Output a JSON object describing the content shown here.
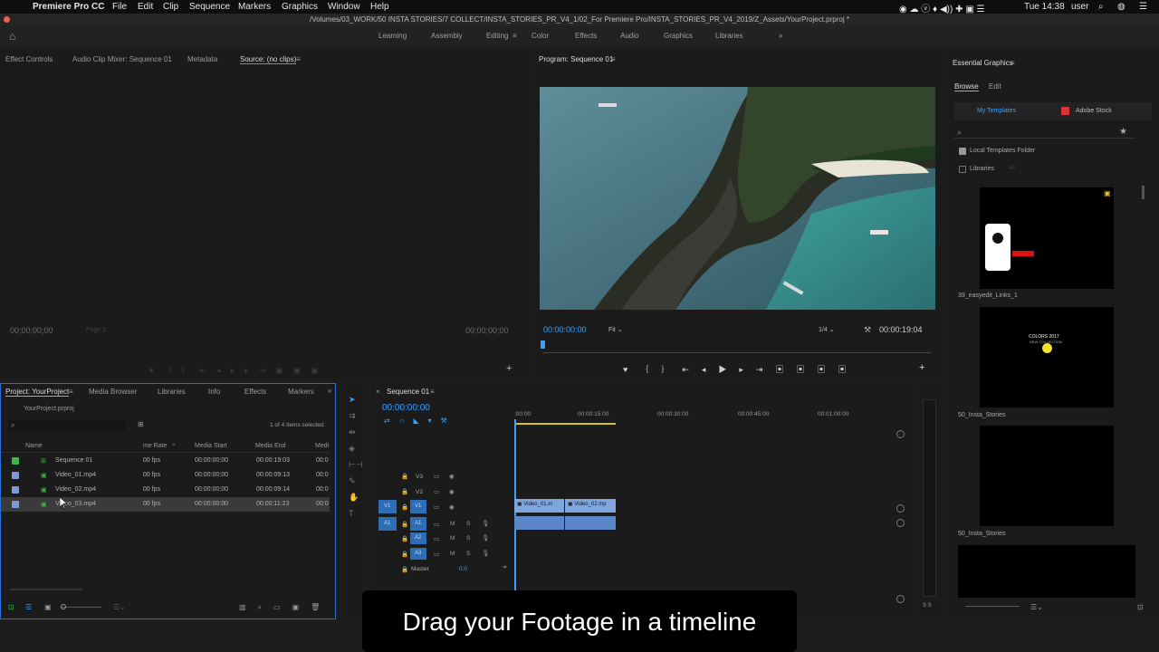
{
  "menubar": {
    "apple": "",
    "app": "Premiere Pro CC",
    "items": [
      "File",
      "Edit",
      "Clip",
      "Sequence",
      "Markers",
      "Graphics",
      "Window",
      "Help"
    ],
    "clock": "Tue 14:38",
    "user": "user"
  },
  "titlebar": {
    "path": "/Volumes/03_WORK/50 INSTA STORIES/7 COLLECT/INSTA_STORIES_PR_V4_1/02_For Premiere Pro/INSTA_STORIES_PR_V4_2019/Z_Assets/YourProject.prproj *"
  },
  "workspaces": {
    "items": [
      "Learning",
      "Assembly",
      "Editing",
      "Color",
      "Effects",
      "Audio",
      "Graphics",
      "Libraries"
    ],
    "active": "Editing",
    "more": "»"
  },
  "source": {
    "tabs": [
      "Effect Controls",
      "Audio Clip Mixer: Sequence 01",
      "Metadata",
      "Source: (no clips)"
    ],
    "tc_left": "00;00;00;00",
    "tc_right": "00;00;00;00",
    "page": "Page 1"
  },
  "program": {
    "title": "Program: Sequence 01",
    "tc": "00:00:00:00",
    "fit": "Fit",
    "ratio": "1/4",
    "duration": "00:00:19:04"
  },
  "essential": {
    "title": "Essential Graphics",
    "tabs": [
      "Browse",
      "Edit"
    ],
    "my_templates": "My Templates",
    "adobe_stock": "Adobe Stock",
    "local_folder": "Local Templates Folder",
    "libraries": "Libraries",
    "libraries_filter": "All",
    "items": [
      "39_easyedit_Links_1",
      "50_Insta_Stories",
      "50_Insta_Stories"
    ],
    "colors_title": "COLORS 2017",
    "colors_sub": "NEW COLLECTION"
  },
  "project": {
    "tabs": [
      "Project: YourProject",
      "Media Browser",
      "Libraries",
      "Info",
      "Effects",
      "Markers"
    ],
    "file": "YourProject.prproj",
    "selected": "1 of 4 items selected",
    "columns": [
      "Name",
      "me Rate",
      "Media Start",
      "Media End",
      "Medi"
    ],
    "rows": [
      {
        "name": "Sequence 01",
        "rate": "00 fps",
        "start": "00:00:00:00",
        "end": "00:00:19:03",
        "med": "00:0",
        "color": "#3cb54a"
      },
      {
        "name": "Video_01.mp4",
        "rate": "00 fps",
        "start": "00:00:00:00",
        "end": "00:00:09:13",
        "med": "00:0",
        "color": "#7b9ad6"
      },
      {
        "name": "Video_02.mp4",
        "rate": "00 fps",
        "start": "00:00:00:00",
        "end": "00:00:09:14",
        "med": "00:0",
        "color": "#7b9ad6"
      },
      {
        "name": "Video_03.mp4",
        "rate": "00 fps",
        "start": "00:00:00:00",
        "end": "00:00:11:23",
        "med": "00:0",
        "color": "#7b9ad6"
      }
    ]
  },
  "timeline": {
    "title": "Sequence 01",
    "tc": "00:00:00:00",
    "ruler": [
      ":00:00",
      "00:00:15:00",
      "00:00:30:00",
      "00:00:45:00",
      "00:01:00:00"
    ],
    "video_tracks": [
      "V3",
      "V2",
      "V1"
    ],
    "audio_tracks": [
      "A1",
      "A2",
      "A3"
    ],
    "master": "Master",
    "master_val": "0.0",
    "clips": [
      "Video_01.m",
      "Video_02.mp"
    ],
    "m": "M",
    "s": "S",
    "ss": "S S"
  },
  "caption": "Drag your Footage in a timeline"
}
